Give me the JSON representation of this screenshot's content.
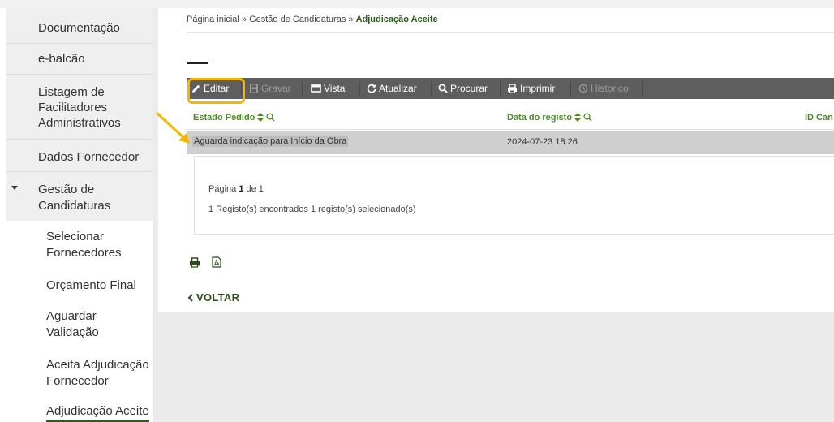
{
  "sidebar": {
    "items": [
      {
        "label": "Documentação"
      },
      {
        "label": "e-balcão"
      },
      {
        "label": "Listagem de Facilitadores Administrativos",
        "lines": [
          "Listagem de",
          "Facilitadores",
          "Administrativos"
        ]
      },
      {
        "label": "Dados Fornecedor"
      },
      {
        "label": "Gestão de Candidaturas",
        "lines": [
          "Gestão de",
          "Candidaturas"
        ]
      }
    ],
    "subitems": [
      {
        "lines": [
          "Selecionar",
          "Fornecedores"
        ]
      },
      {
        "lines": [
          "Orçamento Final"
        ]
      },
      {
        "lines": [
          "Aguardar",
          "Validação"
        ]
      },
      {
        "lines": [
          "Aceita Adjudicação",
          "Fornecedor"
        ]
      },
      {
        "lines": [
          "Adjudicação Aceite"
        ]
      }
    ]
  },
  "breadcrumb": {
    "home": "Página inicial",
    "sep": "»",
    "section": "Gestão de Candidaturas",
    "current": "Adjudicação Aceite"
  },
  "toolbar": {
    "editar": "Editar",
    "gravar": "Gravar",
    "vista": "Vista",
    "atualizar": "Atualizar",
    "procurar": "Procurar",
    "imprimir": "Imprimir",
    "historico": "Historico",
    "highlight_color": "#f2b705"
  },
  "table": {
    "headers": [
      "Estado Pedido",
      "Data do registo",
      "ID Can"
    ],
    "rows": [
      [
        "Aguarda indicação para Início da Obra",
        "2024-07-23 18:26",
        ""
      ]
    ]
  },
  "pager": {
    "prefix": "Página",
    "current": "1",
    "of": "de 1",
    "records": "1 Registo(s) encontrados 1 registo(s) selecionado(s)"
  },
  "back": {
    "label": "VOLTAR"
  },
  "colors": {
    "accent_green": "#4c8a2a",
    "toolbar_bg": "#5e5e5e",
    "arrow": "#f2b705"
  }
}
